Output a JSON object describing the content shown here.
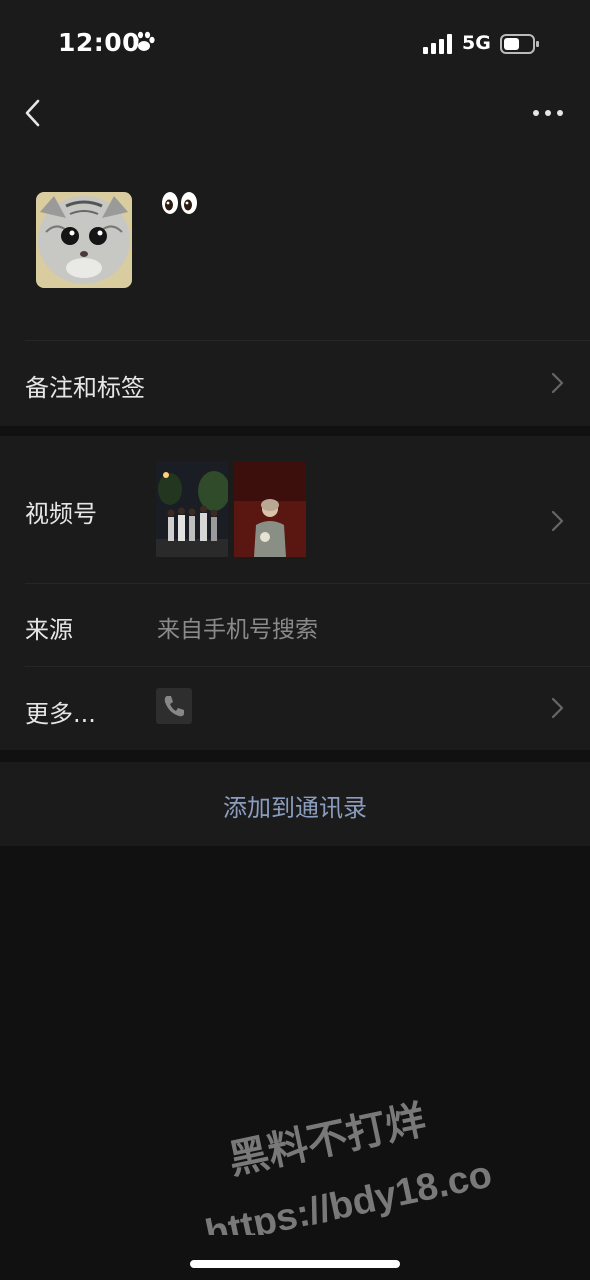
{
  "status_bar": {
    "time": "12:00",
    "network": "5G"
  },
  "contact": {
    "nickname_emoji": "👀"
  },
  "rows": {
    "remark_tags": {
      "label": "备注和标签"
    },
    "channels": {
      "label": "视频号"
    },
    "source": {
      "label": "来源",
      "value": "来自手机号搜索"
    },
    "more": {
      "label": "更多..."
    }
  },
  "actions": {
    "add_to_contacts": "添加到通讯录"
  },
  "watermark": {
    "line1": "黑料不打烊",
    "line2": "https://bdy18.co"
  },
  "icons": [
    "paw-icon",
    "signal-icon",
    "battery-icon",
    "back-chevron-icon",
    "more-dots-icon",
    "chevron-right-icon",
    "phone-icon"
  ],
  "colors": {
    "background": "#111111",
    "panel": "#1b1b1b",
    "link": "#8b9dbf",
    "secondary_text": "#8a8a8a"
  }
}
